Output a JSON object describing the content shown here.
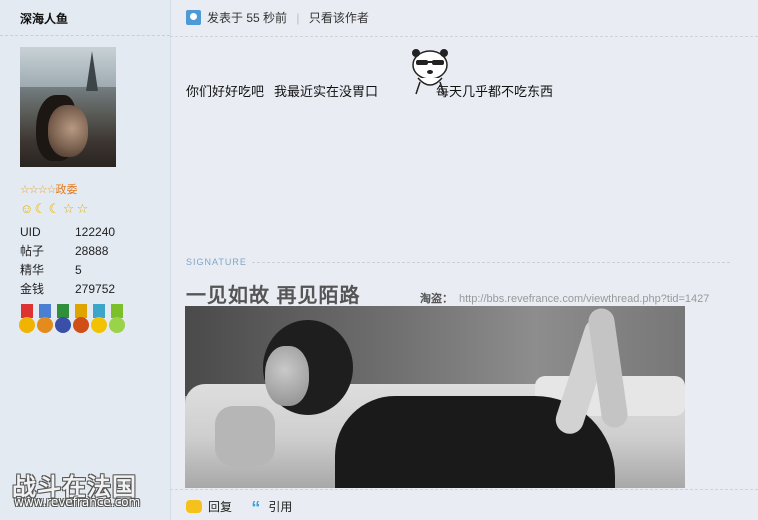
{
  "profile": {
    "username": "深海人鱼",
    "rank_stars": "☆☆☆☆",
    "rank_title": "政委",
    "level_icons": [
      "sun-icon",
      "moon-icon",
      "moon-icon",
      "star-icon",
      "star-icon"
    ],
    "stats": [
      {
        "label": "UID",
        "value": "122240"
      },
      {
        "label": "帖子",
        "value": "28888"
      },
      {
        "label": "精华",
        "value": "5"
      },
      {
        "label": "金钱",
        "value": "279752"
      }
    ],
    "medals": [
      "medal-1",
      "medal-2",
      "medal-3",
      "medal-4",
      "medal-5",
      "medal-6"
    ]
  },
  "post": {
    "posted_prefix": "发表于",
    "posted_time": "55 秒前",
    "only_author": "只看该作者",
    "message_part1": "你们好好吃吧",
    "message_part2": "我最近实在没胃口",
    "message_part3": "每天几乎都不吃东西"
  },
  "signature": {
    "label": "SIGNATURE",
    "title": "一见如故  再见陌路",
    "link_label": "淘盗：",
    "link_url": "http://bbs.revefrance.com/viewthread.php?tid=1427"
  },
  "actions": {
    "reply": "回复",
    "quote": "引用"
  },
  "watermark": {
    "brand": "战斗在法国",
    "url": "www.revefrance.com"
  },
  "colors": {
    "rank": "#e07b20",
    "accent_blue": "#4d9ad6",
    "signature_label": "#7fa6c6"
  }
}
